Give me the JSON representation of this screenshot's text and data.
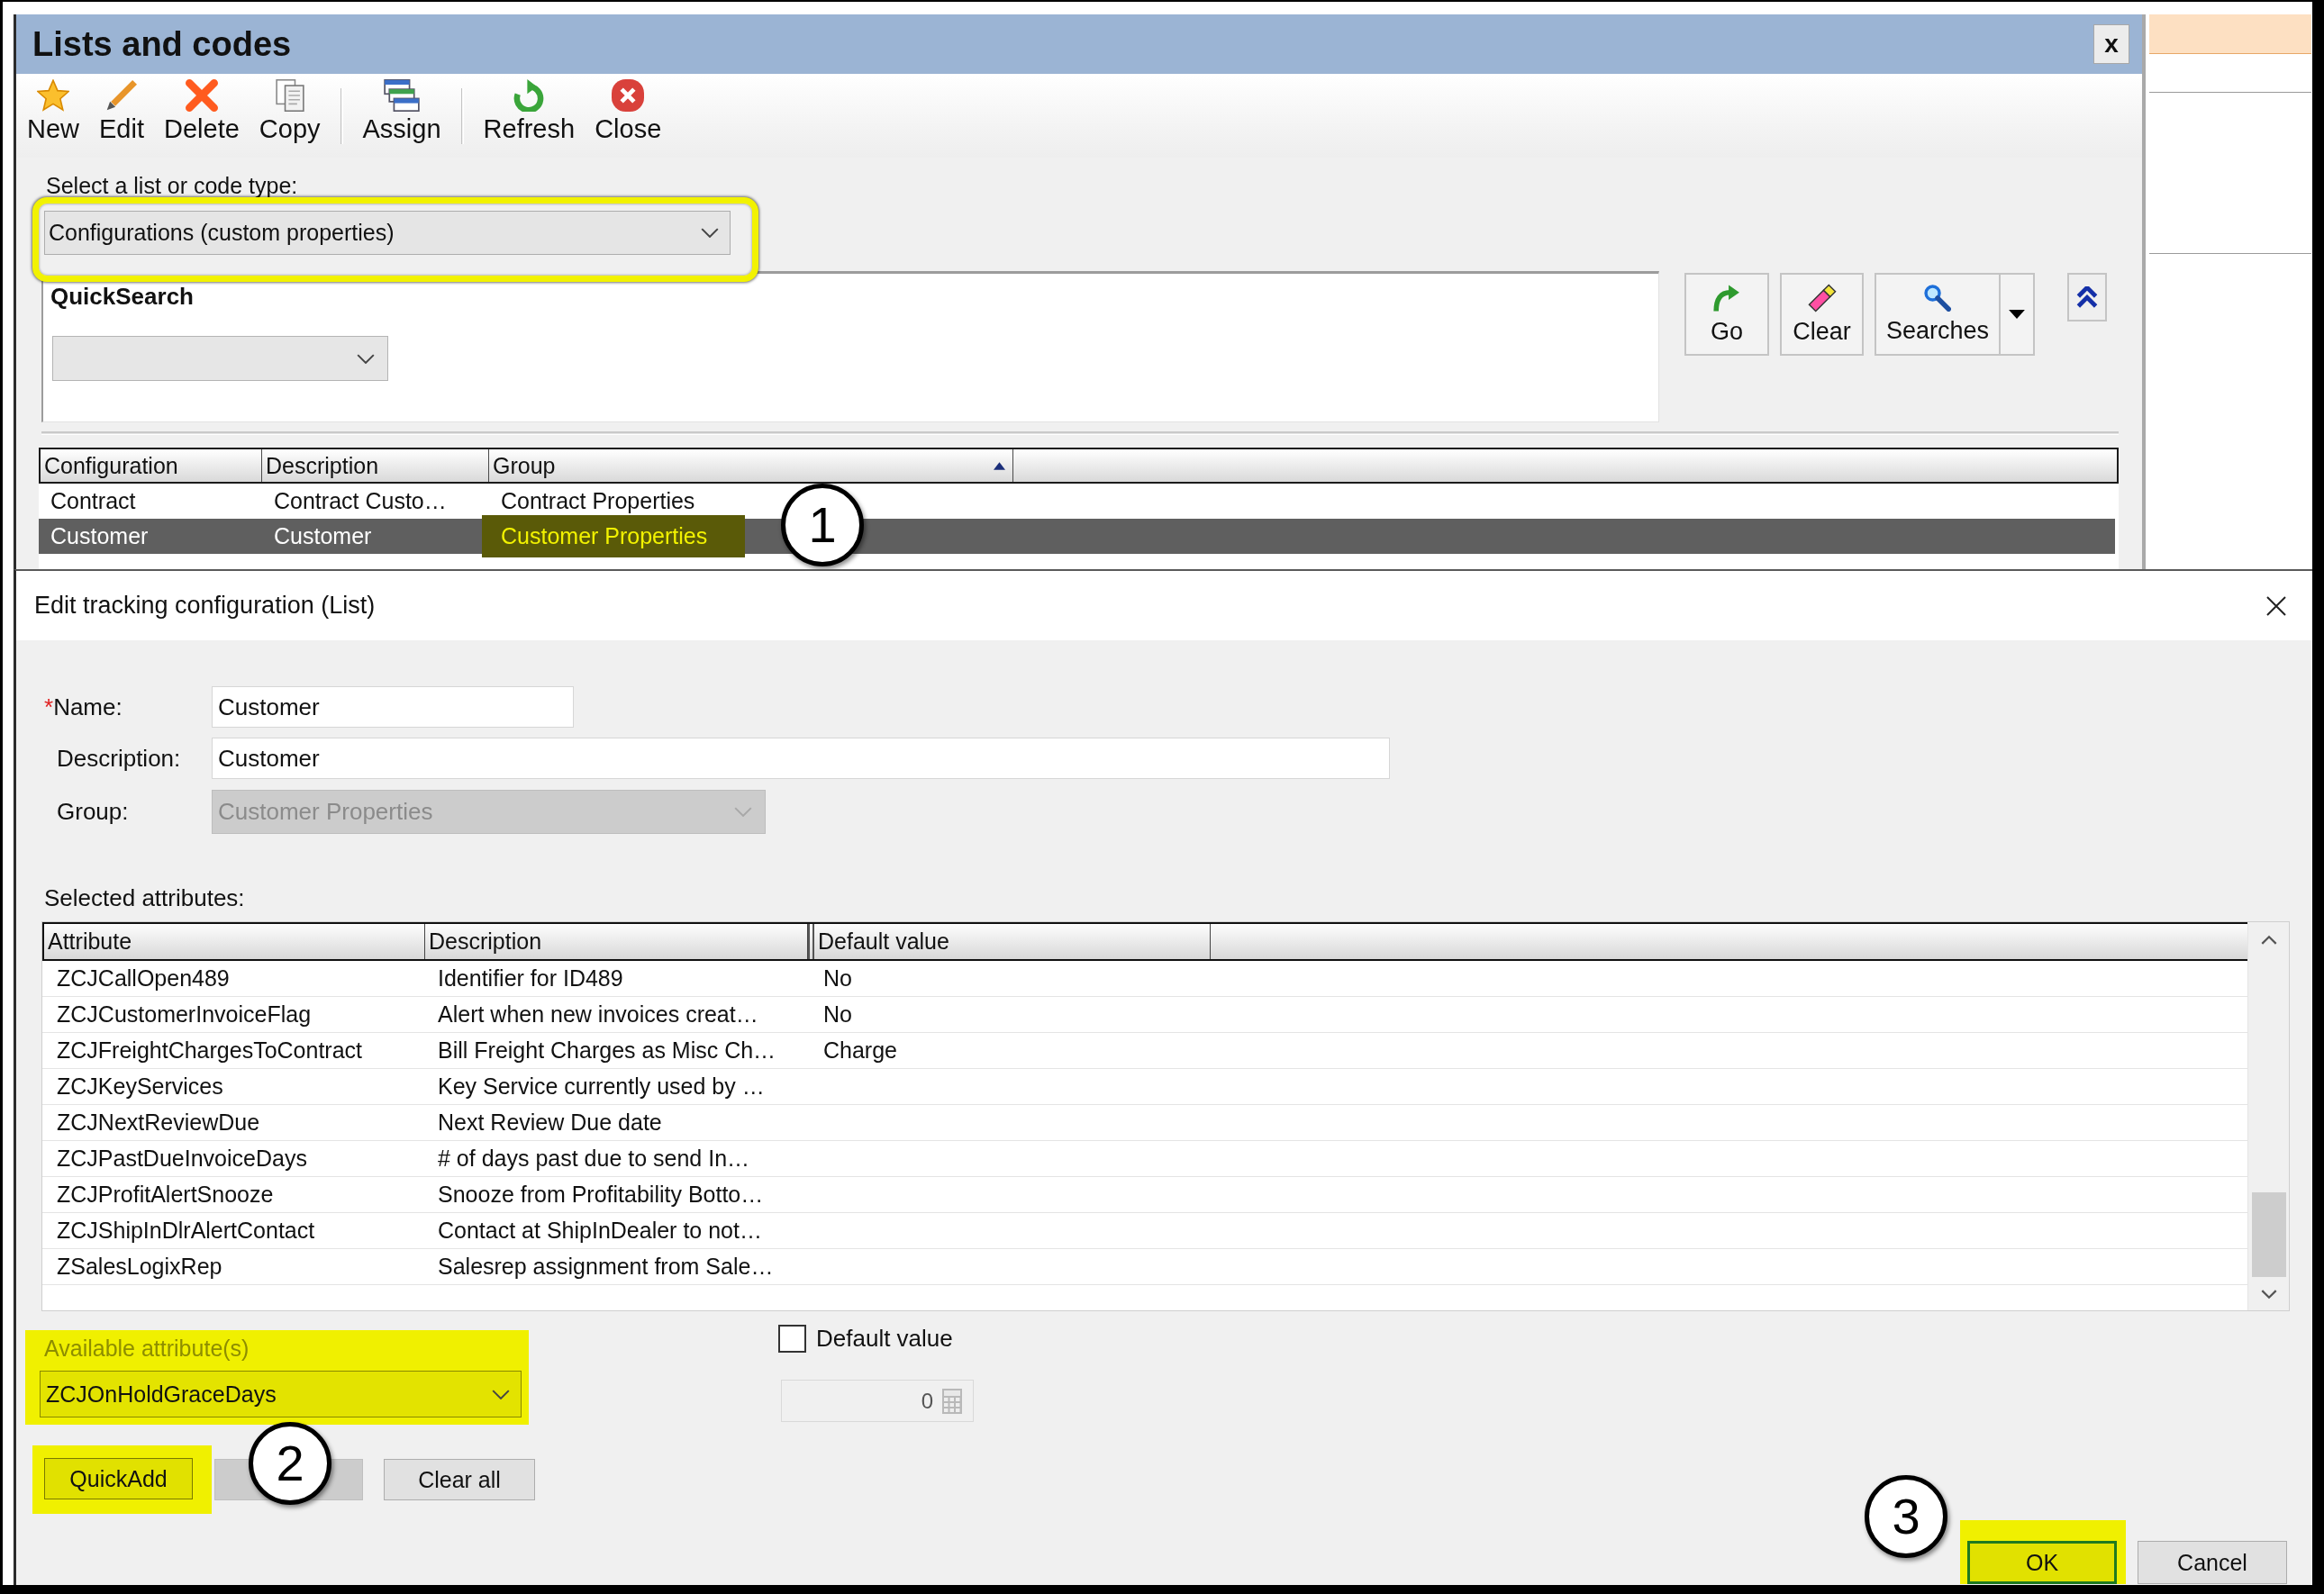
{
  "window": {
    "title": "Lists and codes",
    "close_label": "x"
  },
  "toolbar": [
    {
      "label": "New",
      "kind": "new",
      "separator_before": false
    },
    {
      "label": "Edit",
      "kind": "edit",
      "separator_before": false
    },
    {
      "label": "Delete",
      "kind": "delete",
      "separator_before": false
    },
    {
      "label": "Copy",
      "kind": "copy",
      "separator_before": false
    },
    {
      "label": "Assign",
      "kind": "assign",
      "separator_before": true
    },
    {
      "label": "Refresh",
      "kind": "refresh",
      "separator_before": true
    },
    {
      "label": "Close",
      "kind": "close",
      "separator_before": false
    }
  ],
  "list_type": {
    "label": "Select a list or code type:",
    "value": "Configurations (custom properties)",
    "highlighted": true
  },
  "quick_search": {
    "title": "QuickSearch",
    "buttons": [
      {
        "label": "Go",
        "kind": "go"
      },
      {
        "label": "Clear",
        "kind": "clear"
      },
      {
        "label": "Searches",
        "kind": "searches"
      }
    ]
  },
  "grid": {
    "columns": [
      {
        "label": "Configuration",
        "sorted": false
      },
      {
        "label": "Description",
        "sorted": false
      },
      {
        "label": "Group",
        "sorted": true
      }
    ],
    "rows": [
      {
        "selected": false,
        "cells": [
          {
            "text": "Contract",
            "highlighted": false
          },
          {
            "text": "Contract Custo…",
            "highlighted": false
          },
          {
            "text": "Contract Properties",
            "highlighted": false
          }
        ]
      },
      {
        "selected": true,
        "callout": "1",
        "cells": [
          {
            "text": "Customer",
            "highlighted": false
          },
          {
            "text": "Customer",
            "highlighted": false
          },
          {
            "text": "Customer Properties",
            "highlighted": true
          }
        ]
      }
    ]
  },
  "dialog": {
    "title": "Edit tracking configuration (List)",
    "fields": [
      {
        "kind": "text",
        "required_mark": "*",
        "label": "Name:",
        "value": "Customer",
        "disabled": false
      },
      {
        "kind": "text",
        "label": "Description:",
        "value": "Customer",
        "disabled": false
      },
      {
        "kind": "select",
        "label": "Group:",
        "value": "Customer Properties",
        "disabled": true
      }
    ],
    "selected_attributes": {
      "label": "Selected attributes:",
      "columns": [
        {
          "label": "Attribute"
        },
        {
          "label": "Description"
        },
        {
          "label": "Default value"
        }
      ],
      "rows": [
        {
          "attribute": "ZCJCallOpen489",
          "description": "Identifier for ID489",
          "default_value": "No"
        },
        {
          "attribute": "ZCJCustomerInvoiceFlag",
          "description": "Alert when new invoices creat…",
          "default_value": "No"
        },
        {
          "attribute": "ZCJFreightChargesToContract",
          "description": "Bill Freight Charges as Misc Ch…",
          "default_value": "Charge"
        },
        {
          "attribute": "ZCJKeyServices",
          "description": "Key Service currently used by …"
        },
        {
          "attribute": "ZCJNextReviewDue",
          "description": "Next Review Due date"
        },
        {
          "attribute": "ZCJPastDueInvoiceDays",
          "description": "# of days past due to send In…"
        },
        {
          "attribute": "ZCJProfitAlertSnooze",
          "description": "Snooze from Profitability Botto…"
        },
        {
          "attribute": "ZCJShipInDlrAlertContact",
          "description": "Contact at ShipInDealer to not…"
        },
        {
          "attribute": "ZSalesLogixRep",
          "description": "Salesrep assignment from Sale…"
        }
      ]
    },
    "available_attributes": {
      "label": "Available attribute(s)",
      "value": "ZCJOnHoldGraceDays",
      "highlighted": true
    },
    "attribute_buttons": [
      {
        "label": "QuickAdd",
        "disabled": false,
        "highlighted": true,
        "callout": "2"
      },
      {
        "disabled": true,
        "highlighted": false
      },
      {
        "label": "Clear all",
        "disabled": false,
        "highlighted": false
      }
    ],
    "default_value": {
      "label": "Default value",
      "checked": false,
      "value": "0",
      "disabled": true
    },
    "buttons": [
      {
        "label": "OK",
        "focused": true,
        "highlighted": true,
        "callout": "3"
      },
      {
        "label": "Cancel",
        "focused": false,
        "highlighted": false
      }
    ]
  }
}
